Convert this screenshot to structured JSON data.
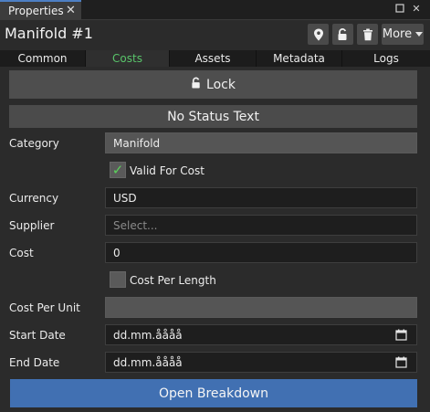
{
  "panel": {
    "tab_title": "Properties"
  },
  "header": {
    "title": "Manifold #1",
    "more_label": "More"
  },
  "tabs": [
    {
      "label": "Common"
    },
    {
      "label": "Costs",
      "active": true
    },
    {
      "label": "Assets"
    },
    {
      "label": "Metadata"
    },
    {
      "label": "Logs"
    }
  ],
  "lock_button": {
    "label": "Lock"
  },
  "status_text": "No Status Text",
  "form": {
    "category": {
      "label": "Category",
      "value": "Manifold"
    },
    "valid_for_cost": {
      "label": "Valid For Cost",
      "checked": true
    },
    "currency": {
      "label": "Currency",
      "value": "USD"
    },
    "supplier": {
      "label": "Supplier",
      "placeholder": "Select..."
    },
    "cost": {
      "label": "Cost",
      "value": "0"
    },
    "cost_per_length": {
      "label": "Cost Per Length",
      "checked": false
    },
    "cost_per_unit": {
      "label": "Cost Per Unit",
      "value": ""
    },
    "start_date": {
      "label": "Start Date",
      "value": "dd.mm.åååå"
    },
    "end_date": {
      "label": "End Date",
      "value": "dd.mm.åååå"
    }
  },
  "open_breakdown": {
    "label": "Open Breakdown"
  },
  "colors": {
    "accent_blue": "#4170b2",
    "active_tab_text": "#59c46a",
    "checkmark": "#5bd15b"
  },
  "icons": [
    "close-icon",
    "maximize-icon",
    "panel-close-icon",
    "location-pin-icon",
    "unlock-icon",
    "trash-icon",
    "chevron-down-icon",
    "calendar-icon",
    "checkmark-icon"
  ]
}
